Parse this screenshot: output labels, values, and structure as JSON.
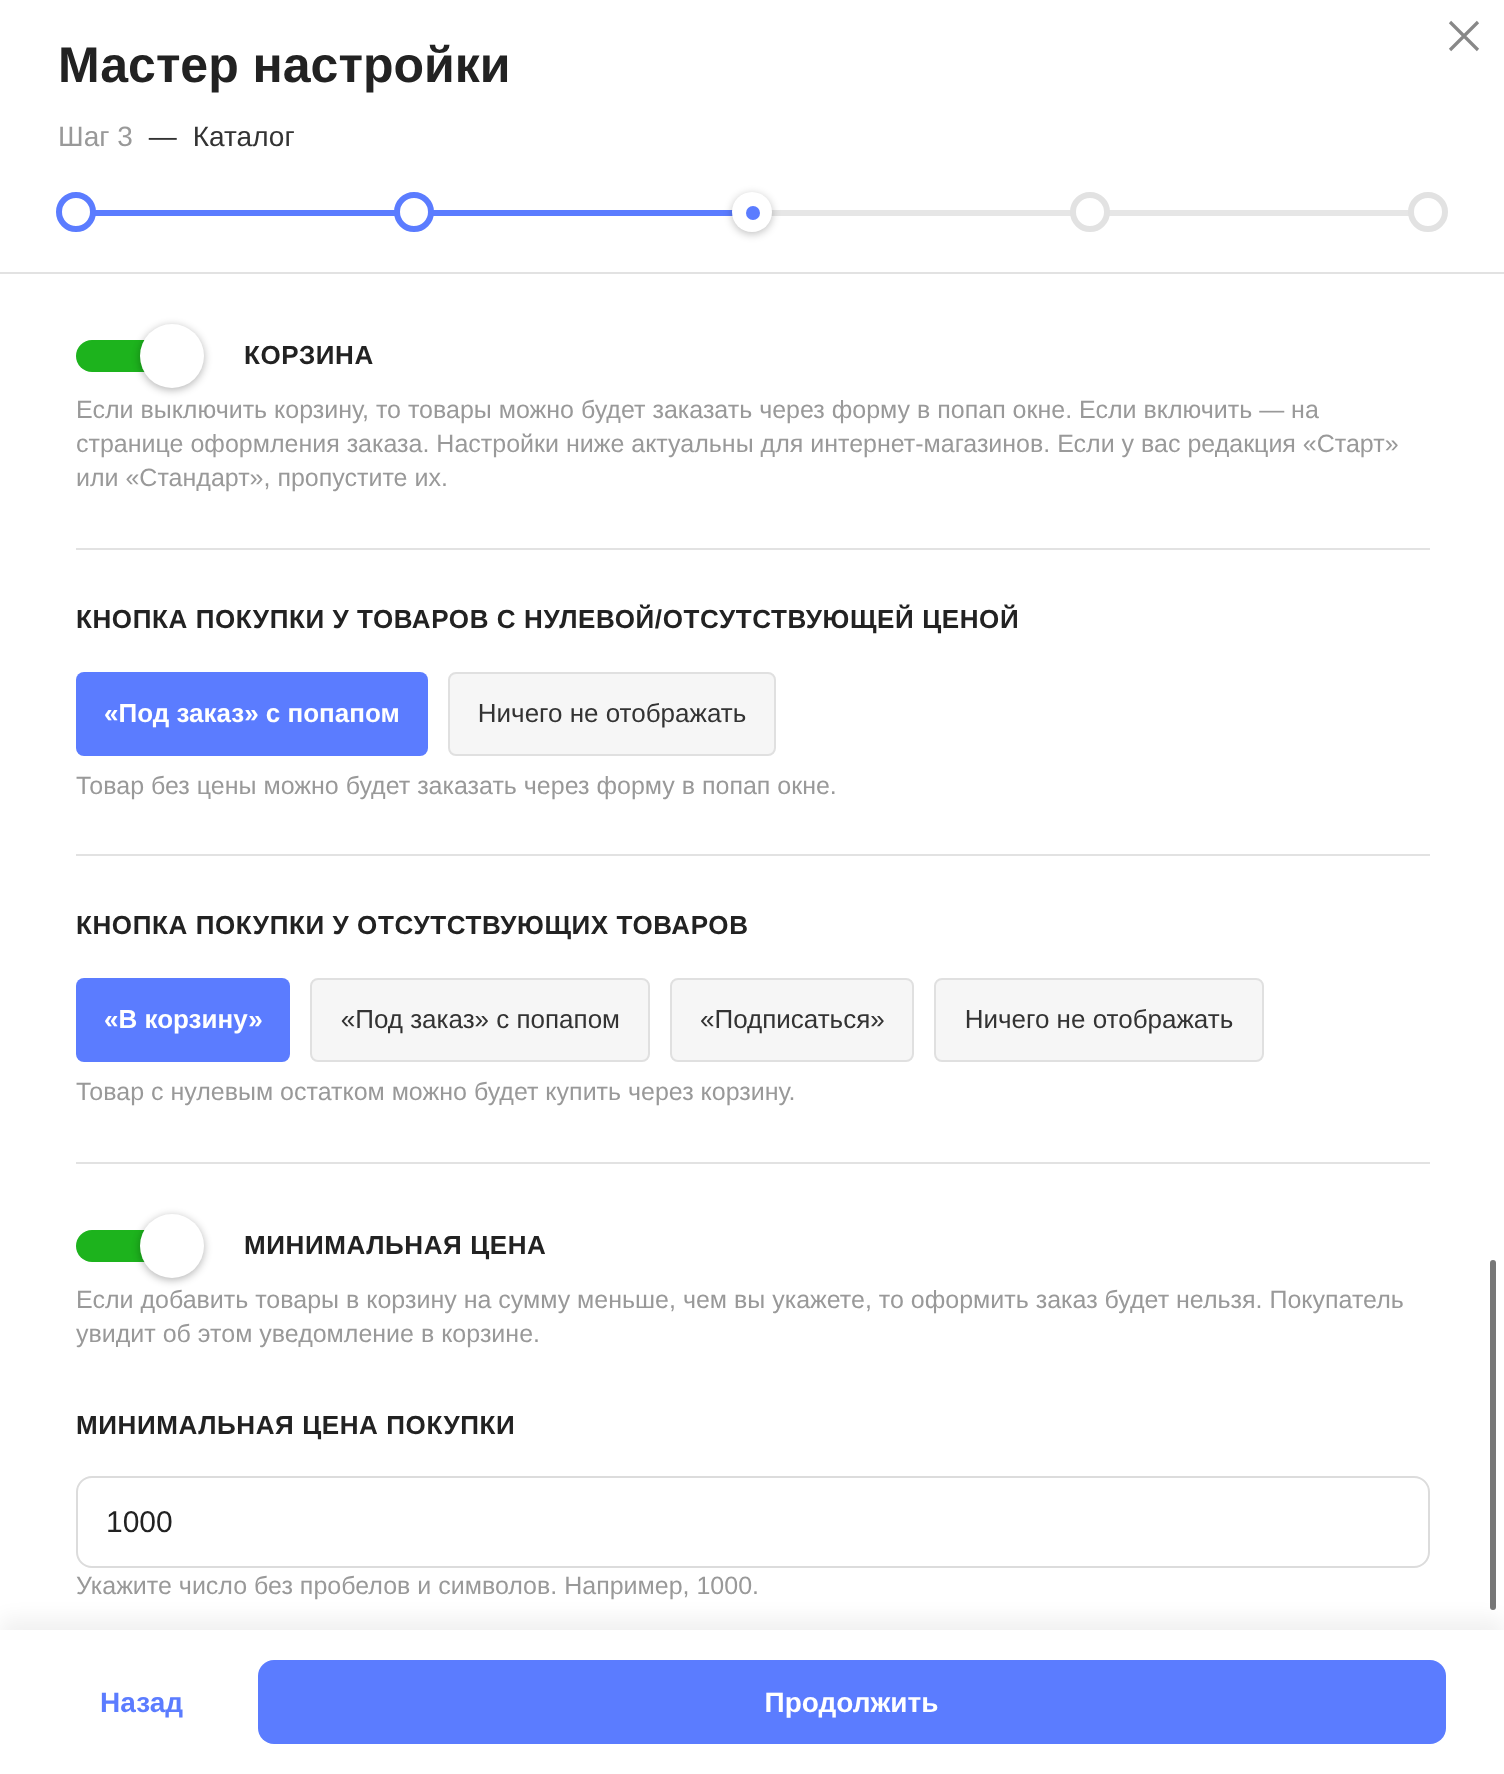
{
  "dialog": {
    "title": "Мастер настройки",
    "step_label": "Шаг 3",
    "step_separator": "—",
    "step_name": "Каталог"
  },
  "steps": [
    {
      "kind": "done"
    },
    {
      "kind": "done"
    },
    {
      "kind": "current"
    },
    {
      "kind": "pending"
    },
    {
      "kind": "pending"
    }
  ],
  "sections": [
    {
      "kind": "toggle",
      "title": "КОРЗИНА",
      "on": true,
      "description": "Если выключить корзину, то товары можно будет заказать через форму в попап окне. Если включить — на странице оформления заказа. Настройки ниже актуальны для интернет-магазинов. Если у вас редакция «Старт» или «Стандарт», пропустите их."
    },
    {
      "kind": "choice",
      "title": "КНОПКА ПОКУПКИ У ТОВАРОВ С НУЛЕВОЙ/ОТСУТСТВУЮЩЕЙ ЦЕНОЙ",
      "options": [
        {
          "label": "«Под заказ» с попапом",
          "selected": true
        },
        {
          "label": "Ничего не отображать",
          "selected": false
        }
      ],
      "hint": "Товар без цены можно будет заказать через форму в попап окне."
    },
    {
      "kind": "choice",
      "title": "КНОПКА ПОКУПКИ У ОТСУТСТВУЮЩИХ ТОВАРОВ",
      "options": [
        {
          "label": "«В корзину»",
          "selected": true
        },
        {
          "label": "«Под заказ» с попапом",
          "selected": false
        },
        {
          "label": "«Подписаться»",
          "selected": false
        },
        {
          "label": "Ничего не отображать",
          "selected": false
        }
      ],
      "hint": "Товар с нулевым остатком можно будет купить через корзину."
    },
    {
      "kind": "toggle",
      "title": "МИНИМАЛЬНАЯ ЦЕНА",
      "on": true,
      "description": "Если добавить товары в корзину на сумму меньше, чем вы укажете, то оформить заказ будет нельзя. Покупатель увидит об этом уведомление в корзине.",
      "field": {
        "label": "МИНИМАЛЬНАЯ ЦЕНА ПОКУПКИ",
        "value": "1000",
        "hint": "Укажите число без пробелов и символов. Например, 1000."
      }
    }
  ],
  "footer": {
    "back": "Назад",
    "next": "Продолжить"
  }
}
